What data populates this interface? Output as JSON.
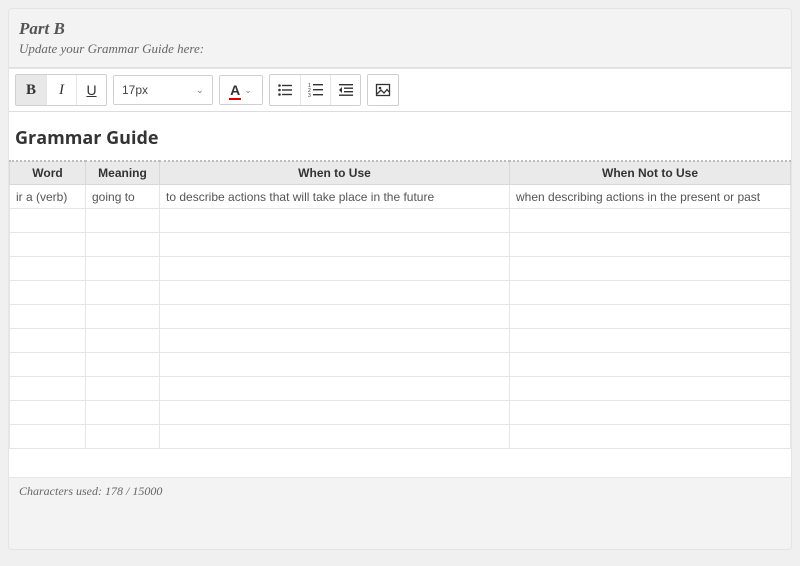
{
  "header": {
    "part_title": "Part B",
    "subtitle": "Update your Grammar Guide here:"
  },
  "toolbar": {
    "font_size": "17px"
  },
  "editor": {
    "title": "Grammar Guide",
    "columns": {
      "word": "Word",
      "meaning": "Meaning",
      "when_to_use": "When to Use",
      "when_not_to_use": "When Not to Use"
    },
    "rows": [
      {
        "word": "ir a (verb)",
        "meaning": "going to",
        "use": "to describe actions that will take place in the future",
        "notuse": "when describing actions in the present or past"
      },
      {
        "word": "",
        "meaning": "",
        "use": "",
        "notuse": ""
      },
      {
        "word": "",
        "meaning": "",
        "use": "",
        "notuse": ""
      },
      {
        "word": "",
        "meaning": "",
        "use": "",
        "notuse": ""
      },
      {
        "word": "",
        "meaning": "",
        "use": "",
        "notuse": ""
      },
      {
        "word": "",
        "meaning": "",
        "use": "",
        "notuse": ""
      },
      {
        "word": "",
        "meaning": "",
        "use": "",
        "notuse": ""
      },
      {
        "word": "",
        "meaning": "",
        "use": "",
        "notuse": ""
      },
      {
        "word": "",
        "meaning": "",
        "use": "",
        "notuse": ""
      },
      {
        "word": "",
        "meaning": "",
        "use": "",
        "notuse": ""
      },
      {
        "word": "",
        "meaning": "",
        "use": "",
        "notuse": ""
      }
    ]
  },
  "footer": {
    "char_count": "Characters used: 178 / 15000"
  }
}
